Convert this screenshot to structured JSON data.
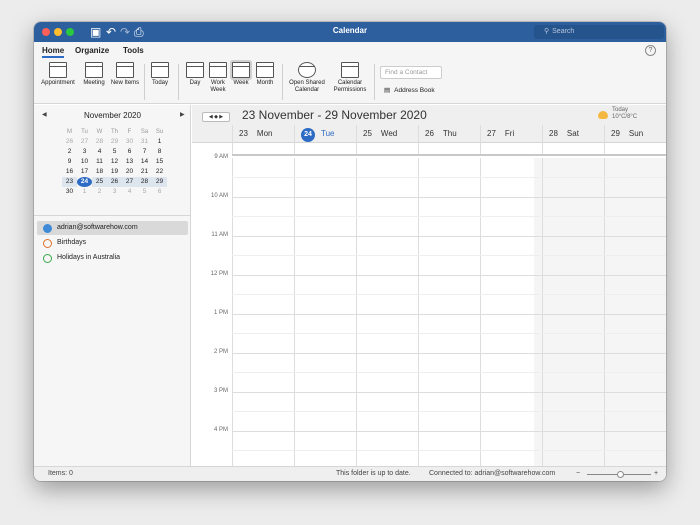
{
  "window": {
    "title": "Calendar",
    "search_placeholder": "Search"
  },
  "ribbon_tabs": [
    "Home",
    "Organize",
    "Tools"
  ],
  "ribbon": {
    "appointment": "Appointment",
    "meeting": "Meeting",
    "new_items": "New Items",
    "today": "Today",
    "day": "Day",
    "work_week": "Work Week",
    "week": "Week",
    "month": "Month",
    "open_shared": "Open Shared Calendar",
    "permissions": "Calendar Permissions",
    "find_contact": "Find a Contact",
    "address_book": "Address Book"
  },
  "mini_calendar": {
    "title": "November 2020",
    "dow": [
      "M",
      "Tu",
      "W",
      "Th",
      "F",
      "Sa",
      "Su"
    ],
    "weeks": [
      [
        "26",
        "27",
        "28",
        "29",
        "30",
        "31",
        "1"
      ],
      [
        "2",
        "3",
        "4",
        "5",
        "6",
        "7",
        "8"
      ],
      [
        "9",
        "10",
        "11",
        "12",
        "13",
        "14",
        "15"
      ],
      [
        "16",
        "17",
        "18",
        "19",
        "20",
        "21",
        "22"
      ],
      [
        "23",
        "24",
        "25",
        "26",
        "27",
        "28",
        "29"
      ],
      [
        "30",
        "1",
        "2",
        "3",
        "4",
        "5",
        "6"
      ]
    ]
  },
  "calendars": [
    {
      "name": "adrian@softwarehow.com",
      "color": "#3e8ad6"
    },
    {
      "name": "Birthdays",
      "color": "#e0702b"
    },
    {
      "name": "Holidays in Australia",
      "color": "#3aa74a"
    }
  ],
  "main": {
    "range": "23 November - 29 November 2020",
    "weather": {
      "label": "Today",
      "temp": "10°C/8°C"
    },
    "days": [
      {
        "num": "23",
        "name": "Mon"
      },
      {
        "num": "24",
        "name": "Tue"
      },
      {
        "num": "25",
        "name": "Wed"
      },
      {
        "num": "26",
        "name": "Thu"
      },
      {
        "num": "27",
        "name": "Fri"
      },
      {
        "num": "28",
        "name": "Sat"
      },
      {
        "num": "29",
        "name": "Sun"
      }
    ],
    "hours": [
      "9 AM",
      "10 AM",
      "11 AM",
      "12 PM",
      "1 PM",
      "2 PM",
      "3 PM",
      "4 PM"
    ]
  },
  "status": {
    "items": "Items: 0",
    "folder": "This folder is up to date.",
    "connected": "Connected to: adrian@softwarehow.com",
    "zoom_level": 0.5
  }
}
